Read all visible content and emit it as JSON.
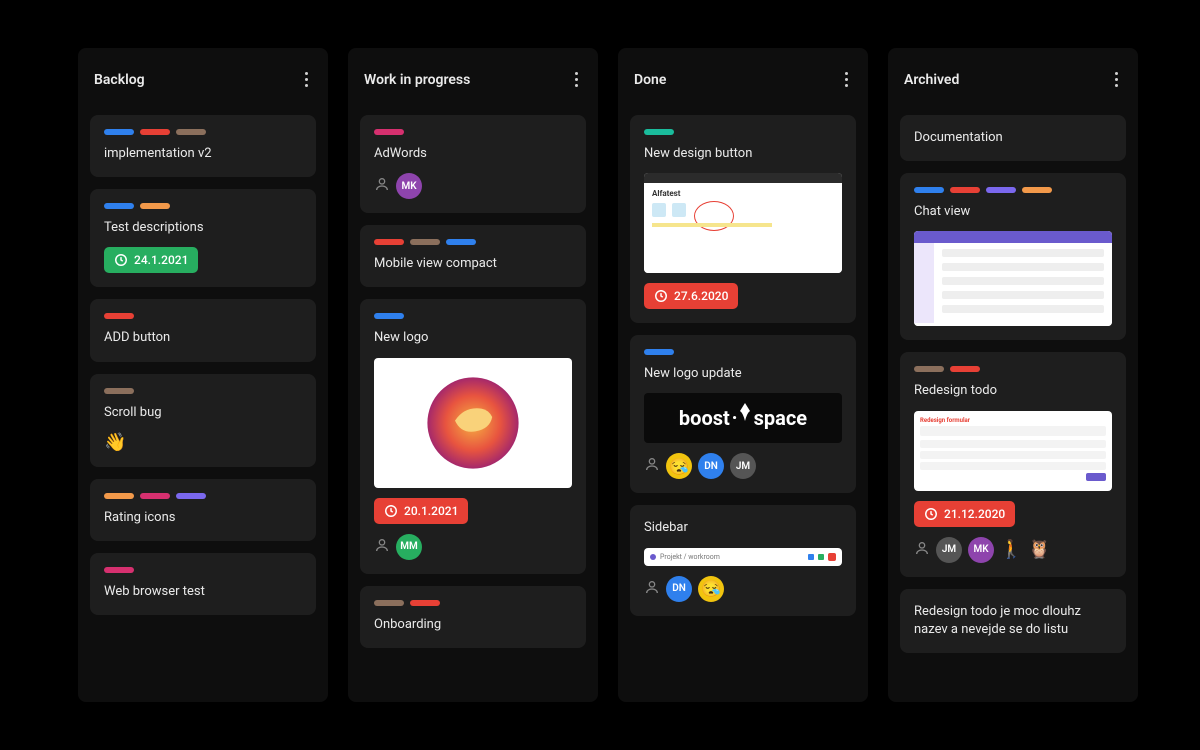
{
  "columns": [
    {
      "title": "Backlog",
      "cards": [
        {
          "tags": [
            "#2f80ed",
            "#e74035",
            "#8b6f5c"
          ],
          "title": "implementation v2"
        },
        {
          "tags": [
            "#2f80ed",
            "#f2994a"
          ],
          "title": "Test descriptions",
          "date": "24.1.2021",
          "date_color": "green"
        },
        {
          "tags": [
            "#e74035"
          ],
          "title": "ADD button"
        },
        {
          "tags": [
            "#8b6f5c"
          ],
          "title": "Scroll bug",
          "emoji": "👋"
        },
        {
          "tags": [
            "#f2994a",
            "#d6306f",
            "#7b68ee"
          ],
          "title": "Rating icons"
        },
        {
          "tags": [
            "#d6306f"
          ],
          "title": "Web browser test"
        }
      ]
    },
    {
      "title": "Work in progress",
      "cards": [
        {
          "tags": [
            "#d6306f"
          ],
          "title": "AdWords",
          "avatars": [
            {
              "bg": "#8e44ad",
              "txt": "MK"
            }
          ],
          "show_person_icon": true
        },
        {
          "tags": [
            "#e74035",
            "#8b6f5c",
            "#2f80ed"
          ],
          "title": "Mobile view compact"
        },
        {
          "tags": [
            "#2f80ed"
          ],
          "title": "New logo",
          "thumb": "lion",
          "thumb_h": 130,
          "date": "20.1.2021",
          "date_color": "red",
          "avatars": [
            {
              "bg": "#27ae60",
              "txt": "MM"
            }
          ],
          "show_person_icon": true
        },
        {
          "tags": [
            "#8b6f5c",
            "#e74035"
          ],
          "title": "Onboarding"
        }
      ]
    },
    {
      "title": "Done",
      "cards": [
        {
          "tags": [
            "#1abc9c"
          ],
          "title": "New design button",
          "thumb": "browser",
          "thumb_h": 100,
          "date": "27.6.2020",
          "date_color": "red"
        },
        {
          "tags": [
            "#2f80ed"
          ],
          "title": "New logo update",
          "thumb": "boost",
          "thumb_h": 50,
          "thumb_dark": true,
          "avatars": [
            {
              "bg": "#f1c40f",
              "txt": "😪",
              "emoji": true
            },
            {
              "bg": "#2f80ed",
              "txt": "DN"
            },
            {
              "bg": "#555",
              "txt": "JM"
            }
          ],
          "show_person_icon": true
        },
        {
          "title": "Sidebar",
          "thumb": "bar",
          "thumb_h": 18,
          "avatars": [
            {
              "bg": "#2f80ed",
              "txt": "DN"
            },
            {
              "bg": "#f1c40f",
              "txt": "😪",
              "emoji": true
            }
          ],
          "show_person_icon": true
        }
      ]
    },
    {
      "title": "Archived",
      "cards": [
        {
          "title": "Documentation"
        },
        {
          "tags": [
            "#2f80ed",
            "#e74035",
            "#7b68ee",
            "#f2994a"
          ],
          "title": "Chat view",
          "thumb": "app",
          "thumb_h": 95
        },
        {
          "tags": [
            "#8b6f5c",
            "#e74035"
          ],
          "title": "Redesign todo",
          "thumb": "form",
          "thumb_h": 80,
          "date": "21.12.2020",
          "date_color": "red",
          "avatars": [
            {
              "bg": "#555",
              "txt": "JM"
            },
            {
              "bg": "#8e44ad",
              "txt": "MK"
            }
          ],
          "extra_emojis": [
            "🚶",
            "🦉"
          ],
          "show_person_icon": true
        },
        {
          "title": "Redesign todo je moc dlouhz nazev a nevejde se do listu"
        }
      ]
    }
  ]
}
